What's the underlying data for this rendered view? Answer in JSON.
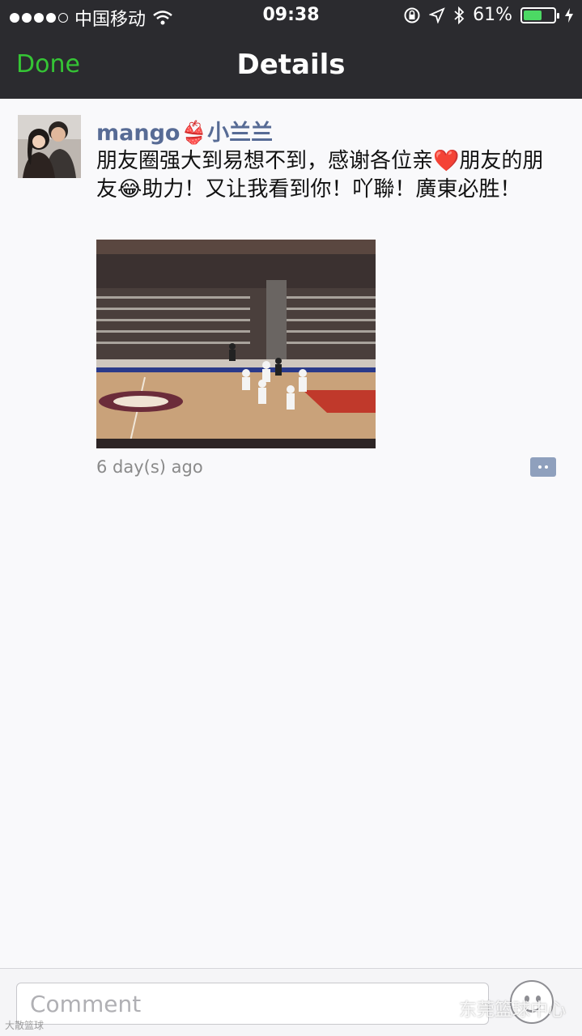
{
  "status_bar": {
    "carrier": "中国移动",
    "time": "09:38",
    "battery_percent_text": "61%",
    "battery_level": 0.61
  },
  "nav": {
    "done_label": "Done",
    "title": "Details"
  },
  "post": {
    "author": "mango👙小兰兰",
    "text": "朋友圈强大到易想不到，感谢各位亲❤️朋友的朋友😂助力！又让我看到你！吖聯！廣東必胜！",
    "time_ago": "6 day(s) ago"
  },
  "comment_bar": {
    "placeholder": "Comment"
  },
  "watermark": {
    "right_text": "东莞篮球中心",
    "left_text": "大散篮球"
  },
  "colors": {
    "accent_green": "#35c535",
    "link_blue": "#576b95",
    "nav_bg": "#2b2b2f"
  },
  "icons": [
    "wifi-icon",
    "lock-rotation-icon",
    "location-icon",
    "bluetooth-icon",
    "battery-icon",
    "charging-icon",
    "comment-dots-icon",
    "emoji-icon",
    "wechat-icon"
  ]
}
